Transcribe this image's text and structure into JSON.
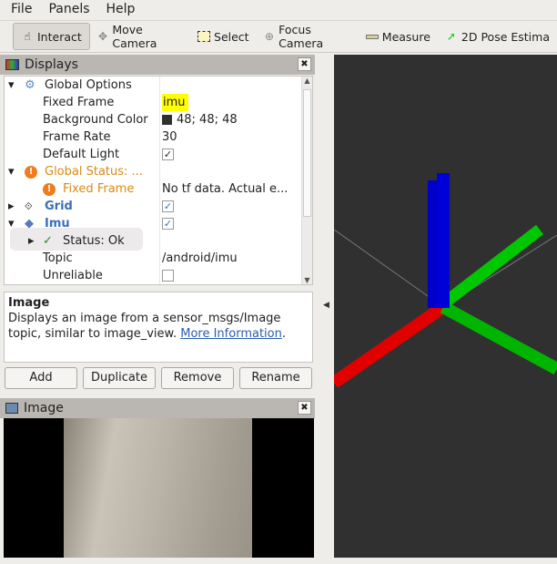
{
  "menu": [
    {
      "label": "File"
    },
    {
      "label": "Panels"
    },
    {
      "label": "Help"
    }
  ],
  "toolbar": [
    {
      "label": "Interact",
      "icon": "hand-icon",
      "active": true
    },
    {
      "label": "Move Camera",
      "icon": "move-icon"
    },
    {
      "label": "Select",
      "icon": "select-box-icon"
    },
    {
      "label": "Focus Camera",
      "icon": "crosshair-icon"
    },
    {
      "label": "Measure",
      "icon": "ruler-icon"
    },
    {
      "label": "2D Pose Estima",
      "icon": "green-arrow-icon"
    }
  ],
  "displays": {
    "title": "Displays",
    "rows": {
      "global_options": "Global Options",
      "fixed_frame": "Fixed Frame",
      "fixed_frame_value": "imu",
      "background_color": "Background Color",
      "background_color_value": "48; 48; 48",
      "frame_rate": "Frame Rate",
      "frame_rate_value": "30",
      "default_light": "Default Light",
      "global_status": "Global Status: ...",
      "status_fixed_frame": "Fixed Frame",
      "status_fixed_frame_value": "No tf data.  Actual e...",
      "grid": "Grid",
      "imu": "Imu",
      "imu_status": "Status: Ok",
      "topic": "Topic",
      "topic_value": "/android/imu",
      "unreliable": "Unreliable"
    }
  },
  "description": {
    "title": "Image",
    "text": "Displays an image from a sensor_msgs/Image topic, similar to image_view. ",
    "link": "More Information",
    "end": "."
  },
  "buttons": {
    "add": "Add",
    "duplicate": "Duplicate",
    "remove": "Remove",
    "rename": "Rename"
  },
  "image_panel": {
    "title": "Image"
  },
  "colors": {
    "background": "#303030",
    "x_axis": "#e00000",
    "y_axis": "#00c800",
    "z_axis": "#0000d0",
    "highlight": "#ffff00"
  }
}
